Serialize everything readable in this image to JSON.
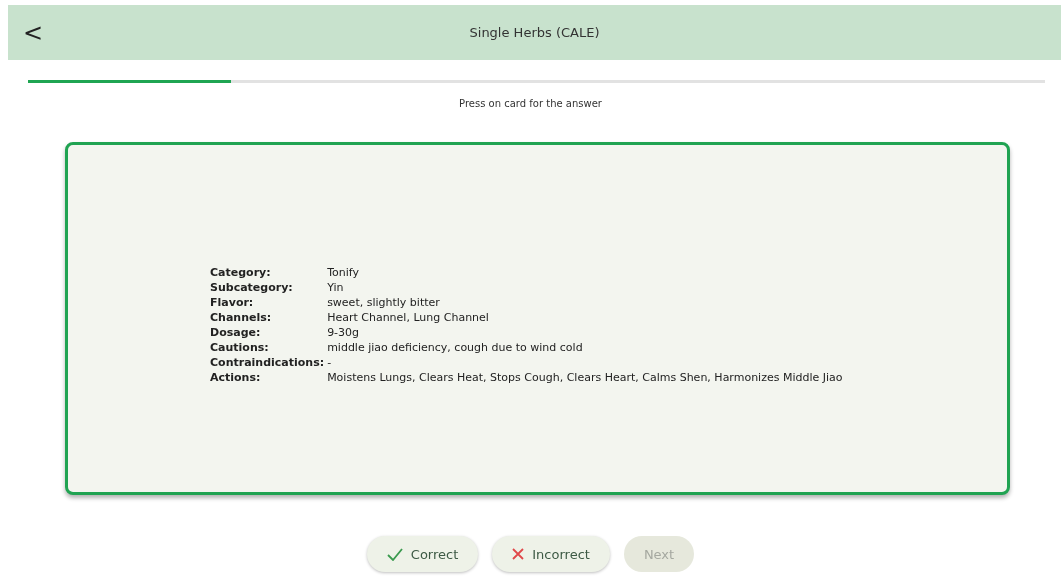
{
  "header": {
    "back": "<",
    "title": "Single Herbs (CALE)"
  },
  "progress": {
    "level": 0.2
  },
  "hint": "Press on card for the answer",
  "card": {
    "fields": [
      {
        "label": "Category:",
        "value": "Tonify"
      },
      {
        "label": "Subcategory:",
        "value": "Yin"
      },
      {
        "label": "Flavor:",
        "value": "sweet, slightly bitter"
      },
      {
        "label": "Channels:",
        "value": "Heart Channel, Lung Channel"
      },
      {
        "label": "Dosage:",
        "value": "9-30g"
      },
      {
        "label": "Cautions:",
        "value": "middle jiao deficiency, cough due to wind cold"
      },
      {
        "label": "Contraindications:",
        "value": "-"
      },
      {
        "label": "Actions:",
        "value": "Moistens Lungs, Clears Heat, Stops Cough, Clears Heart, Calms Shen, Harmonizes Middle Jiao"
      }
    ]
  },
  "buttons": [
    {
      "kind": "correct",
      "label": "Correct",
      "disabled": false
    },
    {
      "kind": "incorrect",
      "label": "Incorrect",
      "disabled": false
    },
    {
      "kind": "next",
      "label": "Next",
      "disabled": true
    }
  ]
}
